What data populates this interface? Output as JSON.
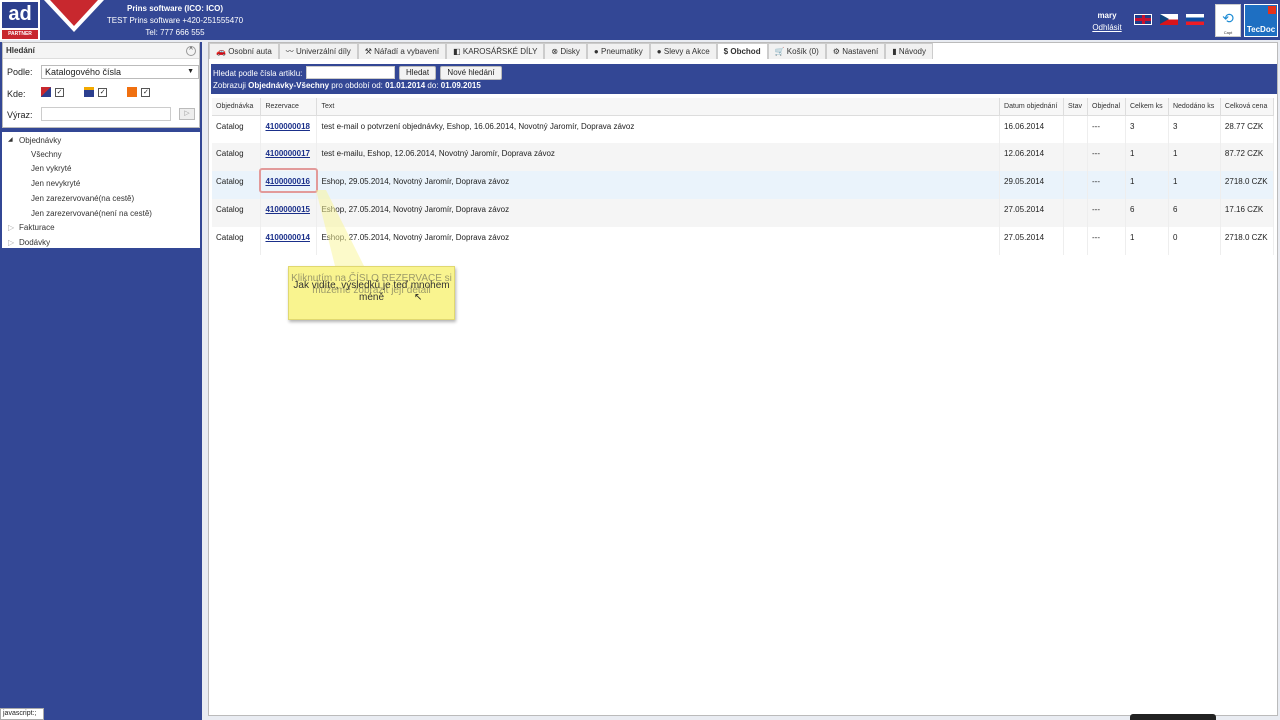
{
  "header": {
    "logo_text": "ad",
    "logo_sub": "PARTNER",
    "company": "Prins software (ICO: ICO)",
    "company_line2": "TEST Prins software +420-251555470",
    "phone": "Tel: 777 666 555",
    "user": "mary",
    "logout": "Odhlásit",
    "capt_label": "Capt",
    "tecdoc": "TecDoc"
  },
  "search": {
    "title": "Hledání",
    "by_label": "Podle:",
    "by_value": "Katalogového čísla",
    "where_label": "Kde:",
    "expr_label": "Výraz:",
    "expr_value": ""
  },
  "tree": {
    "root": "Objednávky",
    "children": [
      "Všechny",
      "Jen vykryté",
      "Jen nevykryté",
      "Jen zarezervované(na cestě)",
      "Jen zarezervované(není na cestě)"
    ],
    "others": [
      "Fakturace",
      "Dodávky"
    ]
  },
  "tabs": [
    "Osobní auta",
    "Univerzální díly",
    "Nářadí a vybavení",
    "KAROSÁŘSKÉ DÍLY",
    "Disky",
    "Pneumatiky",
    "Slevy a Akce",
    "Obchod",
    "Košík (0)",
    "Nastavení",
    "Návody"
  ],
  "searchbar": {
    "label": "Hledat podle čísla artiklu:",
    "input_value": "",
    "search_btn": "Hledat",
    "new_btn": "Nové hledání",
    "info_prefix": "Zobrazuji",
    "info_bold": "Objednávky-Všechny",
    "info_mid": "pro období od:",
    "date_from": "01.01.2014",
    "info_to": "do:",
    "date_to": "01.09.2015"
  },
  "table": {
    "columns": [
      "Objednávka",
      "Rezervace",
      "Text",
      "Datum objednání",
      "Stav",
      "Objednal",
      "Celkem ks",
      "Nedodáno ks",
      "Celková cena"
    ],
    "rows": [
      [
        "Catalog",
        "4100000018",
        "test e-mail o potvrzení objednávky, Eshop, 16.06.2014, Novotný Jaromír, Doprava závoz",
        "16.06.2014",
        "",
        "---",
        "3",
        "3",
        "28.77 CZK"
      ],
      [
        "Catalog",
        "4100000017",
        "test e-mailu, Eshop, 12.06.2014, Novotný Jaromír, Doprava závoz",
        "12.06.2014",
        "",
        "---",
        "1",
        "1",
        "87.72 CZK"
      ],
      [
        "Catalog",
        "4100000016",
        "Eshop, 29.05.2014, Novotný Jaromír, Doprava závoz",
        "29.05.2014",
        "",
        "---",
        "1",
        "1",
        "2718.0 CZK"
      ],
      [
        "Catalog",
        "4100000015",
        "Eshop, 27.05.2014, Novotný Jaromír, Doprava závoz",
        "27.05.2014",
        "",
        "---",
        "6",
        "6",
        "17.16 CZK"
      ],
      [
        "Catalog",
        "4100000014",
        "Eshop, 27.05.2014, Novotný Jaromír, Doprava závoz",
        "27.05.2014",
        "",
        "---",
        "1",
        "0",
        "2718.0 CZK"
      ]
    ]
  },
  "tooltip": {
    "fading": "Kliknutím na ČÍSLO REZERVACE si můžeme zobrazit její detail",
    "current": "Jak vidíte, výsledků je teď mnohem méně"
  },
  "statusbar": "javascript:;"
}
